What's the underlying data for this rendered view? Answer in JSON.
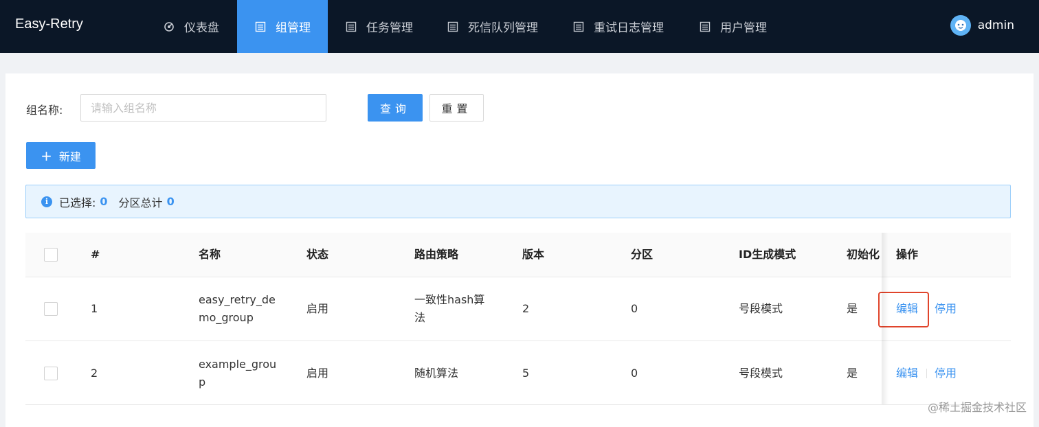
{
  "app": {
    "brand": "Easy-Retry"
  },
  "nav": {
    "items": [
      {
        "label": "仪表盘",
        "icon": "dashboard-icon",
        "active": false
      },
      {
        "label": "组管理",
        "icon": "list-icon",
        "active": true
      },
      {
        "label": "任务管理",
        "icon": "list-icon",
        "active": false
      },
      {
        "label": "死信队列管理",
        "icon": "list-icon",
        "active": false
      },
      {
        "label": "重试日志管理",
        "icon": "list-icon",
        "active": false
      },
      {
        "label": "用户管理",
        "icon": "list-icon",
        "active": false
      }
    ]
  },
  "user": {
    "name": "admin"
  },
  "search": {
    "label": "组名称:",
    "placeholder": "请输入组名称",
    "value": "",
    "query_label": "查询",
    "reset_label": "重置"
  },
  "toolbar": {
    "new_label": "新建",
    "new_icon": "plus-icon"
  },
  "alert": {
    "selected_label": "已选择:",
    "selected_count": "0",
    "partition_label": "分区总计",
    "partition_count": "0"
  },
  "table": {
    "headers": {
      "index": "#",
      "name": "名称",
      "status": "状态",
      "route": "路由策略",
      "version": "版本",
      "partition": "分区",
      "id_mode": "ID生成模式",
      "init": "初始化",
      "ops": "操作"
    },
    "rows": [
      {
        "index": "1",
        "name_line1": "easy_retry_de",
        "name_line2": "mo_group",
        "status": "启用",
        "route_line1": "一致性hash算",
        "route_line2": "法",
        "version": "2",
        "partition": "0",
        "id_mode": "号段模式",
        "init": "是",
        "edit": "编辑",
        "disable": "停用"
      },
      {
        "index": "2",
        "name_line1": "example_grou",
        "name_line2": "p",
        "status": "启用",
        "route_line1": "随机算法",
        "route_line2": "",
        "version": "5",
        "partition": "0",
        "id_mode": "号段模式",
        "init": "是",
        "edit": "编辑",
        "disable": "停用"
      }
    ]
  },
  "watermark": "@稀土掘金技术社区",
  "colors": {
    "header_bg": "#0b1727",
    "accent": "#3b93f0",
    "highlight": "#e0442b"
  }
}
